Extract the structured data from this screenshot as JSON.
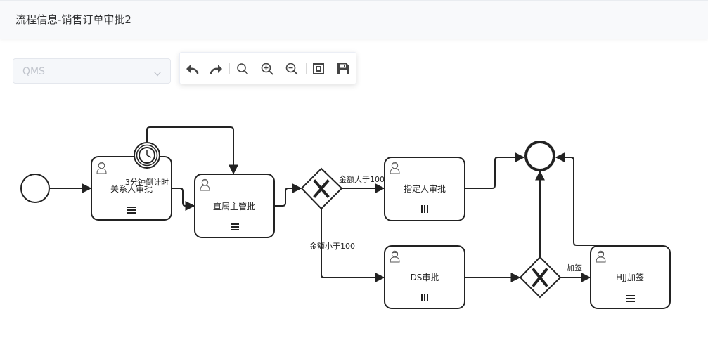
{
  "header": {
    "title": "流程信息-销售订单审批2"
  },
  "process_select": {
    "value": "QMS",
    "icon": "chevron-down-icon"
  },
  "toolbar": {
    "buttons": [
      {
        "icon": "undo-icon"
      },
      {
        "icon": "redo-icon"
      },
      {
        "icon": "search-icon"
      },
      {
        "icon": "zoom-in-icon"
      },
      {
        "icon": "zoom-out-icon"
      },
      {
        "icon": "fit-view-icon"
      },
      {
        "icon": "save-icon"
      }
    ]
  },
  "diagram": {
    "tasks": [
      {
        "id": "task-contact-approve",
        "label": "关系人审批",
        "marker": "sequential"
      },
      {
        "id": "task-direct-manager",
        "label": "直属主管批",
        "marker": "sequential"
      },
      {
        "id": "task-designee-approve",
        "label": "指定人审批",
        "marker": "parallel"
      },
      {
        "id": "task-ds-approve",
        "label": "DS审批",
        "marker": "parallel"
      },
      {
        "id": "task-hjj-sign",
        "label": "HJJ加签",
        "marker": "sequential"
      }
    ],
    "timer_event": {
      "label": "3分钟倒计时"
    },
    "flows": {
      "amount_gt": "金额大于100",
      "amount_lt": "金额小于100",
      "countersign": "加签"
    },
    "colors": {
      "stroke": "#222222",
      "fill": "#ffffff"
    }
  }
}
